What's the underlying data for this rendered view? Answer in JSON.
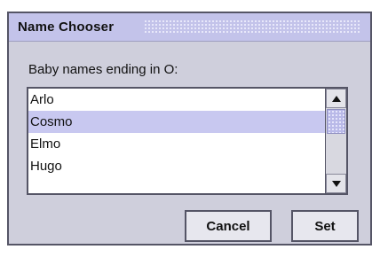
{
  "window": {
    "title": "Name Chooser"
  },
  "dialog": {
    "label": "Baby names ending in O:",
    "list_items": [
      "Arlo",
      "Cosmo",
      "Elmo",
      "Hugo"
    ],
    "selected_item": "Cosmo"
  },
  "buttons": {
    "cancel": "Cancel",
    "set": "Set"
  }
}
